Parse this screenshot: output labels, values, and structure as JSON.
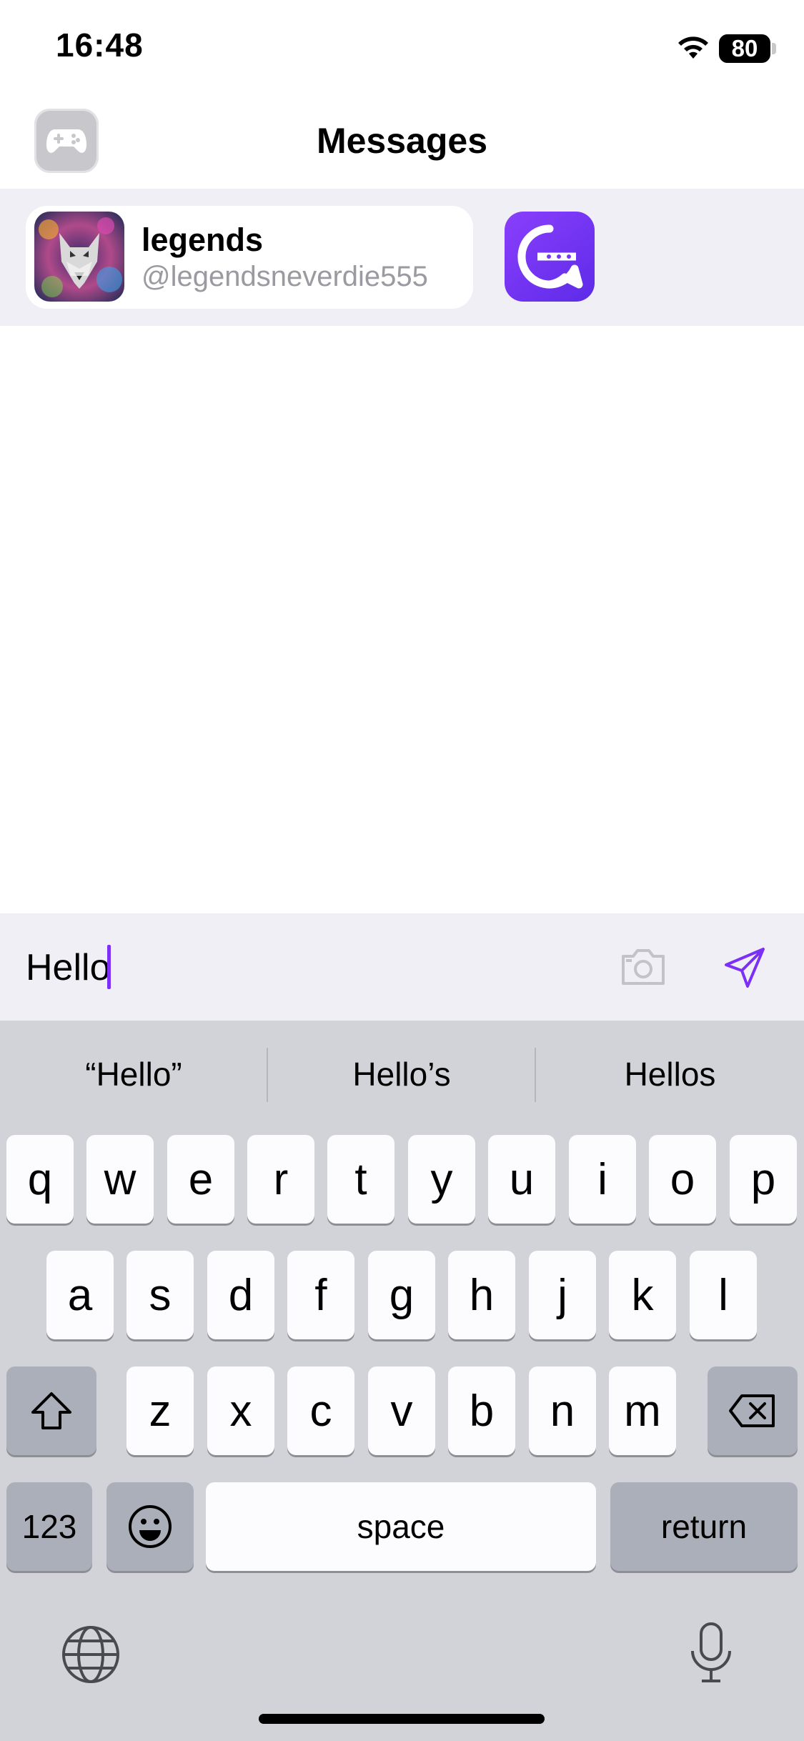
{
  "status_bar": {
    "time": "16:48",
    "battery": "80"
  },
  "header": {
    "title": "Messages",
    "left_icon": "gamepad-icon"
  },
  "chat": {
    "name": "legends",
    "handle": "@legendsneverdie555"
  },
  "composer": {
    "text": "Hello"
  },
  "keyboard": {
    "suggestions": [
      "“Hello”",
      "Hello’s",
      "Hellos"
    ],
    "row1": [
      "q",
      "w",
      "e",
      "r",
      "t",
      "y",
      "u",
      "i",
      "o",
      "p"
    ],
    "row2": [
      "a",
      "s",
      "d",
      "f",
      "g",
      "h",
      "j",
      "k",
      "l"
    ],
    "row3": [
      "z",
      "x",
      "c",
      "v",
      "b",
      "n",
      "m"
    ],
    "numbers_label": "123",
    "space_label": "space",
    "return_label": "return"
  },
  "colors": {
    "accent": "#7b2ff7",
    "background": "#ffffff",
    "strip": "#f0eff5",
    "keyboard": "#d1d3d9"
  }
}
